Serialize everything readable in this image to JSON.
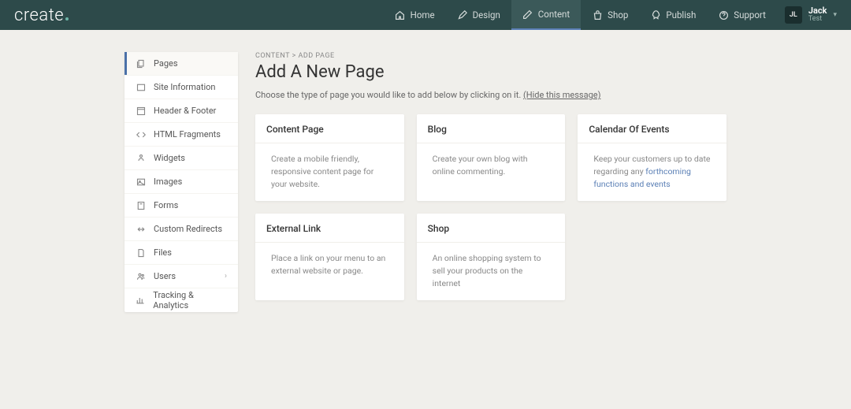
{
  "brand": "create",
  "nav": [
    {
      "key": "home",
      "label": "Home"
    },
    {
      "key": "design",
      "label": "Design"
    },
    {
      "key": "content",
      "label": "Content",
      "active": true
    },
    {
      "key": "shop",
      "label": "Shop"
    },
    {
      "key": "publish",
      "label": "Publish"
    },
    {
      "key": "support",
      "label": "Support"
    }
  ],
  "user": {
    "initials": "JL",
    "name": "Jack",
    "sub": "Test"
  },
  "sidebar": [
    {
      "key": "pages",
      "label": "Pages",
      "active": true
    },
    {
      "key": "site-info",
      "label": "Site Information"
    },
    {
      "key": "header-footer",
      "label": "Header & Footer"
    },
    {
      "key": "html-fragments",
      "label": "HTML Fragments"
    },
    {
      "key": "widgets",
      "label": "Widgets"
    },
    {
      "key": "images",
      "label": "Images"
    },
    {
      "key": "forms",
      "label": "Forms"
    },
    {
      "key": "custom-redirects",
      "label": "Custom Redirects"
    },
    {
      "key": "files",
      "label": "Files"
    },
    {
      "key": "users",
      "label": "Users",
      "expandable": true
    },
    {
      "key": "tracking",
      "label": "Tracking & Analytics"
    }
  ],
  "breadcrumb": {
    "root": "CONTENT",
    "separator": ">",
    "current": "ADD PAGE"
  },
  "title": "Add A New Page",
  "intro_prefix": "Choose the type of page you would like to add below by clicking on it. ",
  "intro_hide": "(Hide this message)",
  "cards": [
    {
      "title": "Content Page",
      "desc": "Create a mobile friendly, responsive content page for your website."
    },
    {
      "title": "Blog",
      "desc": "Create your own blog with online commenting."
    },
    {
      "title": "Calendar Of Events",
      "desc_prefix": "Keep your customers up to date regarding any ",
      "desc_link": "forthcoming functions and events"
    },
    {
      "title": "External Link",
      "desc": "Place a link on your menu to an external website or page."
    },
    {
      "title": "Shop",
      "desc": "An online shopping system to sell your products on the internet"
    }
  ]
}
